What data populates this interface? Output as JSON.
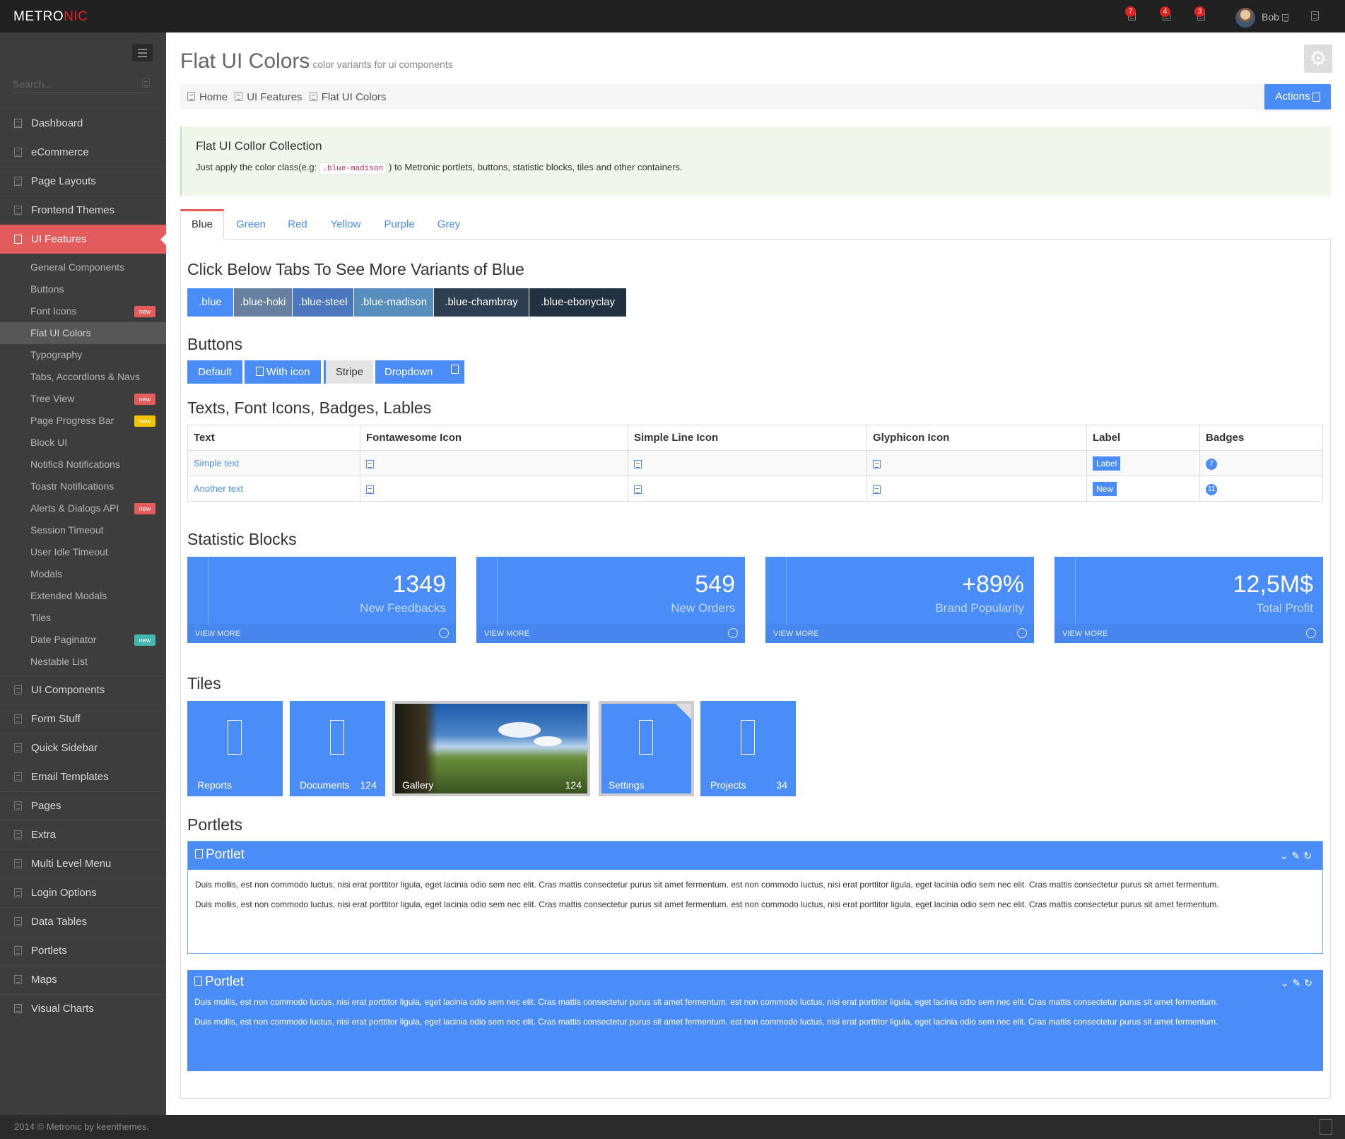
{
  "header": {
    "logo_main": "METRO",
    "logo_accent": "NIC",
    "badges": [
      "7",
      "4",
      "3"
    ],
    "username": "Bob"
  },
  "sidebar": {
    "search_placeholder": "Search...",
    "items": [
      {
        "label": "Dashboard"
      },
      {
        "label": "eCommerce"
      },
      {
        "label": "Page Layouts"
      },
      {
        "label": "Frontend Themes"
      },
      {
        "label": "UI Features"
      }
    ],
    "sub_items": [
      {
        "label": "General Components"
      },
      {
        "label": "Buttons"
      },
      {
        "label": "Font Icons",
        "badge": "new"
      },
      {
        "label": "Flat UI Colors"
      },
      {
        "label": "Typography"
      },
      {
        "label": "Tabs, Accordions & Navs"
      },
      {
        "label": "Tree View",
        "badge": "new"
      },
      {
        "label": "Page Progress Bar",
        "badge": "new"
      },
      {
        "label": "Block UI"
      },
      {
        "label": "Notific8 Notifications"
      },
      {
        "label": "Toastr Notifications"
      },
      {
        "label": "Alerts & Dialogs API",
        "badge": "new"
      },
      {
        "label": "Session Timeout"
      },
      {
        "label": "User Idle Timeout"
      },
      {
        "label": "Modals"
      },
      {
        "label": "Extended Modals"
      },
      {
        "label": "Tiles"
      },
      {
        "label": "Date Paginator",
        "badge": "new"
      },
      {
        "label": "Nestable List"
      }
    ],
    "items_after": [
      {
        "label": "UI Components"
      },
      {
        "label": "Form Stuff"
      },
      {
        "label": "Quick Sidebar"
      },
      {
        "label": "Email Templates"
      },
      {
        "label": "Pages"
      },
      {
        "label": "Extra"
      },
      {
        "label": "Multi Level Menu"
      },
      {
        "label": "Login Options"
      },
      {
        "label": "Data Tables"
      },
      {
        "label": "Portlets"
      },
      {
        "label": "Maps"
      },
      {
        "label": "Visual Charts"
      }
    ],
    "badge_colors": {
      "red": "#e35b5a",
      "yellow": "#f3c200",
      "green": "#45b6af"
    }
  },
  "page": {
    "title": "Flat UI Colors",
    "subtitle": "color variants for ui components",
    "breadcrumb": [
      "Home",
      "UI Features",
      "Flat UI Colors"
    ],
    "actions_label": "Actions"
  },
  "note": {
    "title": "Flat UI Collor Collection",
    "text_before": "Just apply the color class(e.g:",
    "code": ".blue-madison",
    "text_after": ") to Metronic portlets, buttons, statistic blocks, tiles and other containers."
  },
  "tabs": [
    "Blue",
    "Green",
    "Red",
    "Yellow",
    "Purple",
    "Grey"
  ],
  "sections": {
    "variants_title": "Click Below Tabs To See More Variants of Blue",
    "buttons_title": "Buttons",
    "texts_title": "Texts, Font Icons, Badges, Lables",
    "stats_title": "Statistic Blocks",
    "tiles_title": "Tiles",
    "portlets_title": "Portlets"
  },
  "variants": [
    {
      "label": ".blue",
      "color": "#4b8df8"
    },
    {
      "label": ".blue-hoki",
      "color": "#67809f"
    },
    {
      "label": ".blue-steel",
      "color": "#4b77be"
    },
    {
      "label": ".blue-madison",
      "color": "#578ebe"
    },
    {
      "label": ".blue-chambray",
      "color": "#2c3e50"
    },
    {
      "label": ".blue-ebonyclay",
      "color": "#22313f"
    }
  ],
  "buttons": {
    "default": "Default",
    "with_icon": "With icon",
    "stripe": "Stripe",
    "dropdown": "Dropdown"
  },
  "table": {
    "headers": [
      "Text",
      "Fontawesome Icon",
      "Simple Line Icon",
      "Glyphicon Icon",
      "Label",
      "Badges"
    ],
    "rows": [
      {
        "text": "Simple text",
        "label": "Label",
        "badge": "7"
      },
      {
        "text": "Another text",
        "label": "New",
        "badge": "11"
      }
    ]
  },
  "stats": [
    {
      "number": "1349",
      "desc": "New Feedbacks",
      "more": "VIEW MORE"
    },
    {
      "number": "549",
      "desc": "New Orders",
      "more": "VIEW MORE"
    },
    {
      "number": "+89%",
      "desc": "Brand Popularity",
      "more": "VIEW MORE"
    },
    {
      "number": "12,5M$",
      "desc": "Total Profit",
      "more": "VIEW MORE"
    }
  ],
  "tiles": [
    {
      "name": "Reports",
      "num": ""
    },
    {
      "name": "Documents",
      "num": "124"
    },
    {
      "name": "Gallery",
      "num": "124"
    },
    {
      "name": "Settings",
      "num": ""
    },
    {
      "name": "Projects",
      "num": "34"
    }
  ],
  "portlets": [
    {
      "title": "Portlet",
      "p1": "Duis mollis, est non commodo luctus, nisi erat porttitor ligula, eget lacinia odio sem nec elit. Cras mattis consectetur purus sit amet fermentum. est non commodo luctus, nisi erat porttitor ligula, eget lacinia odio sem nec elit. Cras mattis consectetur purus sit amet fermentum.",
      "p2": "Duis mollis, est non commodo luctus, nisi erat porttitor ligula, eget lacinia odio sem nec elit. Cras mattis consectetur purus sit amet fermentum. est non commodo luctus, nisi erat porttitor ligula, eget lacinia odio sem nec elit. Cras mattis consectetur purus sit amet fermentum."
    },
    {
      "title": "Portlet",
      "p1": "Duis mollis, est non commodo luctus, nisi erat porttitor ligula, eget lacinia odio sem nec elit. Cras mattis consectetur purus sit amet fermentum. est non commodo luctus, nisi erat porttitor ligula, eget lacinia odio sem nec elit. Cras mattis consectetur purus sit amet fermentum.",
      "p2": "Duis mollis, est non commodo luctus, nisi erat porttitor ligula, eget lacinia odio sem nec elit. Cras mattis consectetur purus sit amet fermentum. est non commodo luctus, nisi erat porttitor ligula, eget lacinia odio sem nec elit. Cras mattis consectetur purus sit amet fermentum."
    }
  ],
  "footer": {
    "copyright": "2014 © Metronic by keenthemes."
  }
}
